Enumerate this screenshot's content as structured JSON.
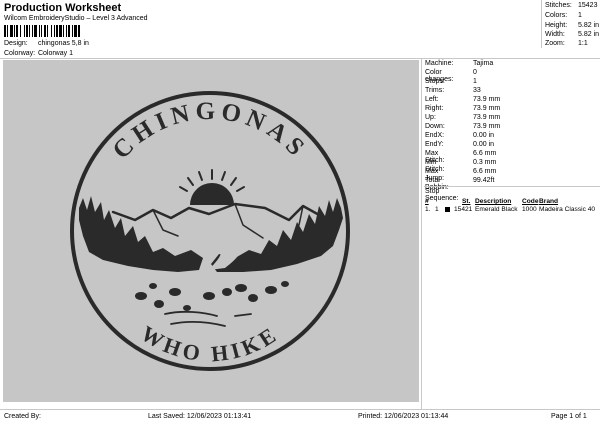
{
  "header": {
    "title": "Production Worksheet",
    "software": "Wilcom EmbroideryStudio – Level 3 Advanced",
    "design_label": "Design:",
    "design_value": "chingonas 5,8 in",
    "colorway_label": "Colorway:",
    "colorway_value": "Colorway 1"
  },
  "stats": [
    {
      "label": "Stitches:",
      "value": "15423"
    },
    {
      "label": "Colors:",
      "value": "1"
    },
    {
      "label": "Height:",
      "value": "5.82 in"
    },
    {
      "label": "Width:",
      "value": "5.82 in"
    },
    {
      "label": "Zoom:",
      "value": "1:1"
    }
  ],
  "design": {
    "top_text": "CHINGONAS",
    "bottom_text": "WHO HIKE",
    "thread_color": "#2a2a2a",
    "background_color": "#c6c6c6"
  },
  "info": [
    {
      "label": "Machine:",
      "value": "Tajima"
    },
    {
      "label": "Color changes:",
      "value": "0"
    },
    {
      "label": "Stops:",
      "value": "1"
    },
    {
      "label": "Trims:",
      "value": "33"
    },
    {
      "label": "Left:",
      "value": "73.9 mm"
    },
    {
      "label": "Right:",
      "value": "73.9 mm"
    },
    {
      "label": "Up:",
      "value": "73.9 mm"
    },
    {
      "label": "Down:",
      "value": "73.9 mm"
    },
    {
      "label": "EndX:",
      "value": "0.00 in"
    },
    {
      "label": "EndY:",
      "value": "0.00 in"
    },
    {
      "label": "Max Stitch:",
      "value": "6.6 mm"
    },
    {
      "label": "Min Stitch:",
      "value": "0.3 mm"
    },
    {
      "label": "Max Jump:",
      "value": "6.6 mm"
    },
    {
      "label": "Total Bobbin:",
      "value": "99.42ft"
    }
  ],
  "stop_sequence": {
    "title": "Stop Sequence:",
    "headers": {
      "no": "#",
      "st": "St.",
      "description": "Description",
      "code": "Code",
      "brand": "Brand"
    },
    "rows": [
      {
        "no": "1.",
        "index": "1",
        "swatch": "#000000",
        "st": "15421",
        "description": "Emerald Black",
        "code": "1000",
        "brand": "Madeira Classic 40"
      }
    ]
  },
  "footer": {
    "created_by": "Created By:",
    "last_saved": "Last Saved: 12/06/2023 01:13:41",
    "printed": "Printed: 12/06/2023 01:13:44",
    "page": "Page 1 of 1"
  }
}
